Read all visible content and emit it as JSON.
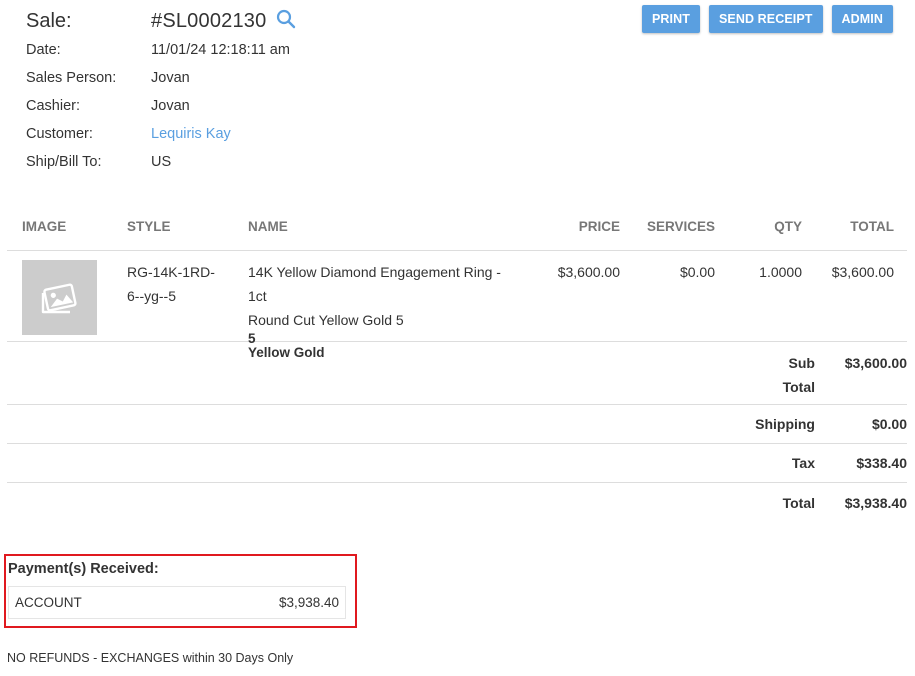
{
  "sale": {
    "label": "Sale:",
    "number": "#SL0002130",
    "search_icon": "search-icon",
    "fields": [
      {
        "label": "Date:",
        "value": "11/01/24 12:18:11 am"
      },
      {
        "label": "Sales Person:",
        "value": "Jovan"
      },
      {
        "label": "Cashier:",
        "value": "Jovan"
      },
      {
        "label": "Customer:",
        "value": "Lequiris Kay"
      },
      {
        "label": "Ship/Bill To:",
        "value": "US"
      }
    ]
  },
  "toolbar": {
    "print_label": "PRINT",
    "send_receipt_label": "SEND RECEIPT",
    "admin_label": "ADMIN"
  },
  "table": {
    "headers": {
      "image": "IMAGE",
      "style": "STYLE",
      "name": "NAME",
      "price": "PRICE",
      "services": "SERVICES",
      "qty": "QTY",
      "total": "TOTAL"
    },
    "items": [
      {
        "image_icon": "image-placeholder-icon",
        "style_line1": "RG-14K-1RD-",
        "style_line2": "6--yg--5",
        "name_line1": "14K Yellow Diamond Engagement Ring - 1ct",
        "name_line2": "Round Cut Yellow Gold 5",
        "name_size": "5",
        "name_metal": "Yellow Gold",
        "price": "$3,600.00",
        "services": "$0.00",
        "qty": "1.0000",
        "total": "$3,600.00"
      }
    ]
  },
  "summary": {
    "subtotal_label_1": "Sub",
    "subtotal_label_2": "Total",
    "subtotal_value": "$3,600.00",
    "shipping_label": "Shipping",
    "shipping_value": "$0.00",
    "tax_label": "Tax",
    "tax_value": "$338.40",
    "total_label": "Total",
    "total_value": "$3,938.40"
  },
  "payments": {
    "title": "Payment(s) Received:",
    "rows": [
      {
        "method": "ACCOUNT",
        "amount": "$3,938.40"
      }
    ],
    "highlight_color": "#e0191f"
  },
  "footer": {
    "note": "NO REFUNDS - EXCHANGES within 30 Days Only"
  },
  "colors": {
    "accent": "#5a9fe0",
    "text": "#333333",
    "header_text": "#777777",
    "divider": "#dddddd"
  }
}
